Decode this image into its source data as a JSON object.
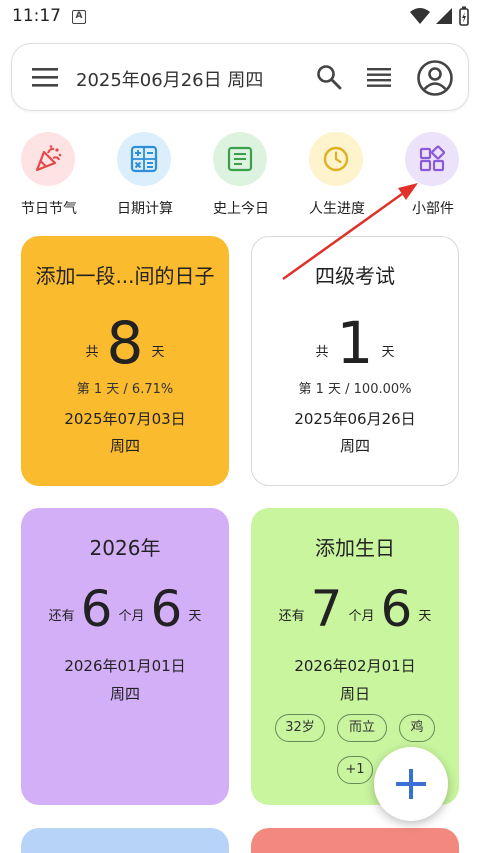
{
  "status_bar": {
    "time": "11:17",
    "badge": "A"
  },
  "search": {
    "date": "2025年06月26日 周四"
  },
  "quick_actions": [
    {
      "label": "节日节气",
      "icon": "party-popper-icon",
      "bg": "#fde3e3",
      "fg": "#e54848"
    },
    {
      "label": "日期计算",
      "icon": "calculator-icon",
      "bg": "#dbeefb",
      "fg": "#2f8fd8"
    },
    {
      "label": "史上今日",
      "icon": "document-icon",
      "bg": "#ddf3e0",
      "fg": "#3aa04a"
    },
    {
      "label": "人生进度",
      "icon": "clock-icon",
      "bg": "#fdf3cc",
      "fg": "#e0b020"
    },
    {
      "label": "小部件",
      "icon": "widgets-icon",
      "bg": "#ece3fb",
      "fg": "#8a5ad8"
    }
  ],
  "cards": [
    {
      "title": "添加一段...间的日子",
      "prefix": "共",
      "number": "8",
      "unit": "天",
      "progress": "第 1 天 / 6.71%",
      "date": "2025年07月03日",
      "weekday": "周四",
      "bg": "#fbbb2e"
    },
    {
      "title": "四级考试",
      "prefix": "共",
      "number": "1",
      "unit": "天",
      "progress": "第 1 天 / 100.00%",
      "date": "2025年06月26日",
      "weekday": "周四",
      "bg": "#ffffff"
    },
    {
      "title": "2026年",
      "prefix": "还有",
      "n1": "6",
      "u1": "个月",
      "n2": "6",
      "u2": "天",
      "date": "2026年01月01日",
      "weekday": "周四",
      "bg": "#d3aff7"
    },
    {
      "title": "添加生日",
      "prefix": "还有",
      "n1": "7",
      "u1": "个月",
      "n2": "6",
      "u2": "天",
      "date": "2026年02月01日",
      "weekday": "周日",
      "tags": [
        "32岁",
        "而立",
        "鸡",
        "+1"
      ],
      "bg": "#c8f59e"
    }
  ],
  "colors": {
    "accent": "#3a6fd8",
    "arrow": "#e0322a",
    "bottom_card_left": "#b7d3f7",
    "bottom_card_right": "#f3897e"
  }
}
